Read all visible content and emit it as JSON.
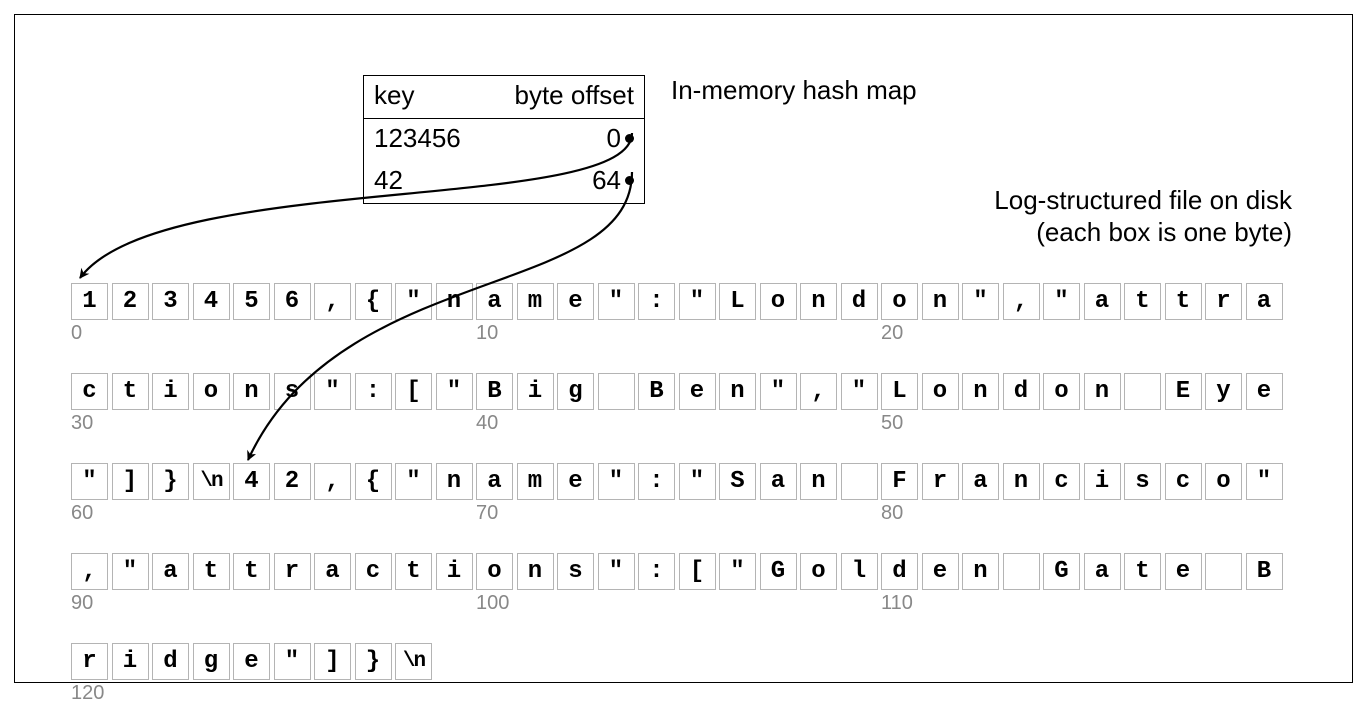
{
  "labels": {
    "hashmap": "In-memory hash map",
    "logfile_l1": "Log-structured file on disk",
    "logfile_l2": "(each box is one byte)"
  },
  "table": {
    "header_key": "key",
    "header_offset": "byte offset",
    "rows": [
      {
        "key": "123456",
        "offset": "0"
      },
      {
        "key": "42",
        "offset": "64"
      }
    ]
  },
  "bytes": [
    "1",
    "2",
    "3",
    "4",
    "5",
    "6",
    ",",
    "{",
    "\"",
    "n",
    "a",
    "m",
    "e",
    "\"",
    ":",
    "\"",
    "L",
    "o",
    "n",
    "d",
    "o",
    "n",
    "\"",
    ",",
    "\"",
    "a",
    "t",
    "t",
    "r",
    "a",
    "c",
    "t",
    "i",
    "o",
    "n",
    "s",
    "\"",
    ":",
    "[",
    "\"",
    "B",
    "i",
    "g",
    " ",
    "B",
    "e",
    "n",
    "\"",
    ",",
    "\"",
    "L",
    "o",
    "n",
    "d",
    "o",
    "n",
    " ",
    "E",
    "y",
    "e",
    "\"",
    "]",
    "}",
    "\\n",
    "4",
    "2",
    ",",
    "{",
    "\"",
    "n",
    "a",
    "m",
    "e",
    "\"",
    ":",
    "\"",
    "S",
    "a",
    "n",
    " ",
    "F",
    "r",
    "a",
    "n",
    "c",
    "i",
    "s",
    "c",
    "o",
    "\"",
    ",",
    "\"",
    "a",
    "t",
    "t",
    "r",
    "a",
    "c",
    "t",
    "i",
    "o",
    "n",
    "s",
    "\"",
    ":",
    "[",
    "\"",
    "G",
    "o",
    "l",
    "d",
    "e",
    "n",
    " ",
    "G",
    "a",
    "t",
    "e",
    " ",
    "B",
    "r",
    "i",
    "d",
    "g",
    "e",
    "\"",
    "]",
    "}",
    "\\n"
  ],
  "ticks": [
    0,
    10,
    20,
    30,
    40,
    50,
    60,
    70,
    80,
    90,
    100,
    110,
    120
  ],
  "row_length": 30
}
